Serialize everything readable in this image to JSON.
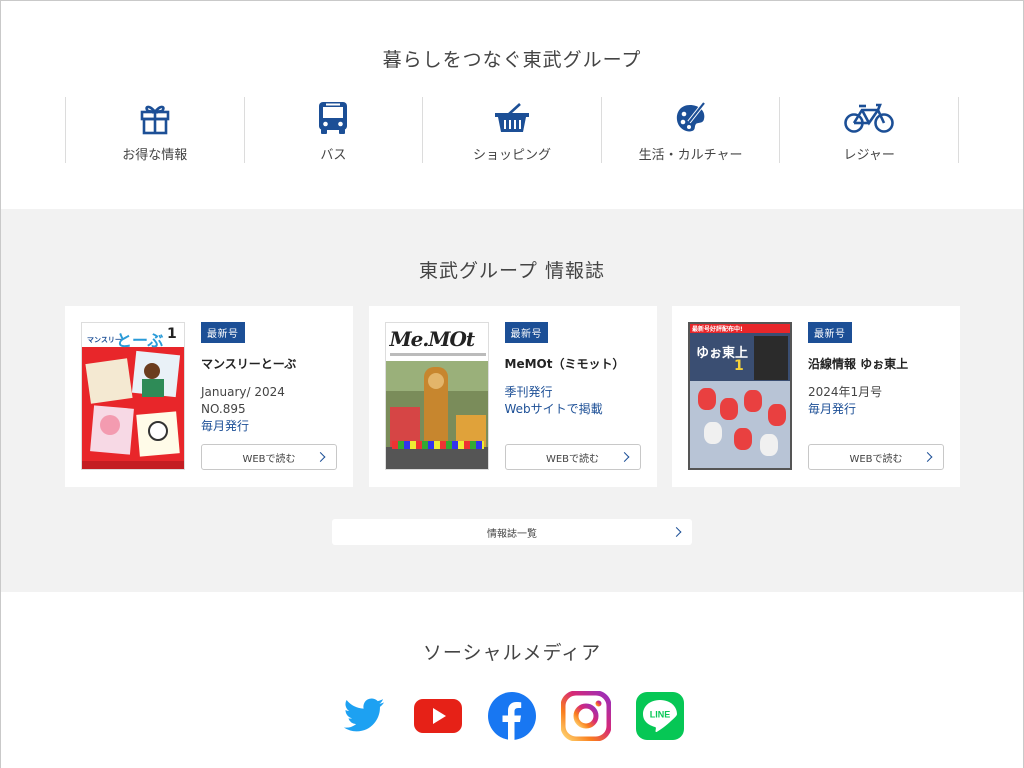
{
  "group_section": {
    "title": "暮らしをつなぐ東武グループ",
    "categories": [
      {
        "label": "お得な情報",
        "icon": "gift-icon"
      },
      {
        "label": "バス",
        "icon": "bus-icon"
      },
      {
        "label": "ショッピング",
        "icon": "shopping-basket-icon"
      },
      {
        "label": "生活・カルチャー",
        "icon": "palette-icon"
      },
      {
        "label": "レジャー",
        "icon": "bicycle-icon"
      }
    ]
  },
  "magazine_section": {
    "title": "東武グループ 情報誌",
    "badge": "最新号",
    "magazines": [
      {
        "name": "マンスリーとーぶ",
        "lines": [
          "January/ 2024",
          "NO.895"
        ],
        "blue_lines": [
          "毎月発行"
        ],
        "button": "WEBで読む"
      },
      {
        "name": "MeMOt（ミモット）",
        "lines": [],
        "blue_lines": [
          "季刊発行",
          "Webサイトで掲載"
        ],
        "button": "WEBで読む"
      },
      {
        "name": "沿線情報 ゆぉ東上",
        "lines": [
          "2024年1月号"
        ],
        "blue_lines": [
          "毎月発行"
        ],
        "button": "WEBで読む"
      }
    ],
    "covers": {
      "c1_title": "マンスリー",
      "c1_logo": "とーぶ",
      "c1_num": "1",
      "c2_logo": "Me.MOt",
      "c3_banner": "最新号好評配布中!",
      "c3_logo": "ゆぉ東上",
      "c3_num": "1"
    },
    "list_button": "情報誌一覧"
  },
  "social_section": {
    "title": "ソーシャルメディア",
    "networks": [
      {
        "icon": "twitter-icon",
        "color": "#1da1f2"
      },
      {
        "icon": "youtube-icon",
        "color": "#e62117"
      },
      {
        "icon": "facebook-icon",
        "color": "#1877f2"
      },
      {
        "icon": "instagram-icon",
        "color": "#d62976"
      },
      {
        "icon": "line-icon",
        "color": "#06c755",
        "label": "LINE"
      }
    ]
  },
  "colors": {
    "brand_blue": "#1c4f96",
    "gray_bg": "#f2f2f2"
  }
}
